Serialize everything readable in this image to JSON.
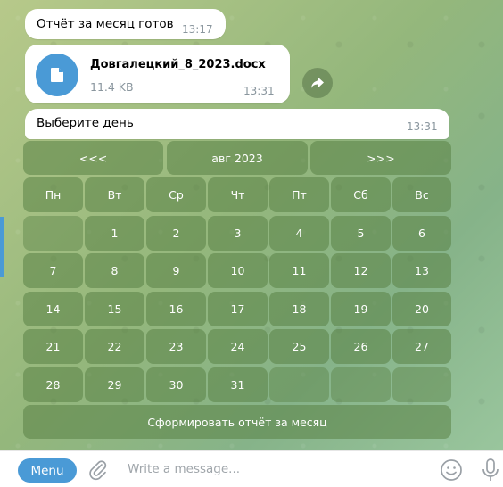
{
  "messages": {
    "report_ready": {
      "text": "Отчёт за месяц готов",
      "time": "13:17"
    },
    "file": {
      "name": "Довгалецкий_8_2023.docx",
      "size": "11.4 KB",
      "time": "13:31"
    },
    "prompt": {
      "text": "Выберите день",
      "time": "13:31"
    }
  },
  "keyboard": {
    "nav": {
      "prev": "<<<",
      "month": "авг 2023",
      "next": ">>>"
    },
    "weekdays": [
      "Пн",
      "Вт",
      "Ср",
      "Чт",
      "Пт",
      "Сб",
      "Вс"
    ],
    "weeks": [
      [
        "",
        "1",
        "2",
        "3",
        "4",
        "5",
        "6"
      ],
      [
        "7",
        "8",
        "9",
        "10",
        "11",
        "12",
        "13"
      ],
      [
        "14",
        "15",
        "16",
        "17",
        "18",
        "19",
        "20"
      ],
      [
        "21",
        "22",
        "23",
        "24",
        "25",
        "26",
        "27"
      ],
      [
        "28",
        "29",
        "30",
        "31",
        "",
        "",
        ""
      ]
    ],
    "report_button": "Сформировать отчёт за месяц"
  },
  "input_bar": {
    "menu_label": "Menu",
    "placeholder": "Write a message..."
  },
  "colors": {
    "accent": "#4a9ad6",
    "keyboard_button": "#5a8246"
  },
  "icons": [
    "document-icon",
    "share-icon",
    "attach-icon",
    "emoji-icon",
    "microphone-icon"
  ]
}
